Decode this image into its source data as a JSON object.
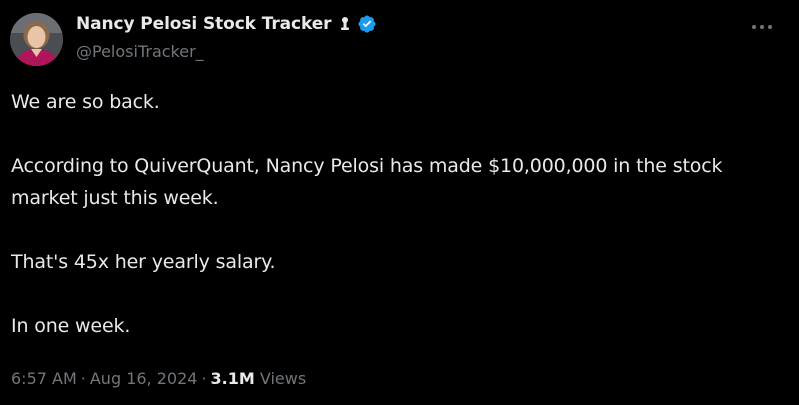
{
  "author": {
    "display_name": "Nancy Pelosi Stock Tracker",
    "handle": "@PelosiTracker_",
    "avatar_icon": "profile-photo",
    "affiliation_icon": "person-badge-icon",
    "verified_icon": "verified-badge-icon",
    "verified_color": "#1d9bf0"
  },
  "menu": {
    "more_icon": "more-horizontal-icon"
  },
  "tweet": {
    "paragraphs": [
      "We are so back.",
      "According to QuiverQuant, Nancy Pelosi has made $10,000,000 in the stock market just this week.",
      "That's 45x her yearly salary.",
      "In one week."
    ]
  },
  "meta": {
    "time": "6:57 AM",
    "separator": "·",
    "date": "Aug 16, 2024",
    "views_count": "3.1M",
    "views_label": "Views"
  },
  "colors": {
    "background": "#000000",
    "primary_text": "#e7e9ea",
    "secondary_text": "#71767b"
  }
}
